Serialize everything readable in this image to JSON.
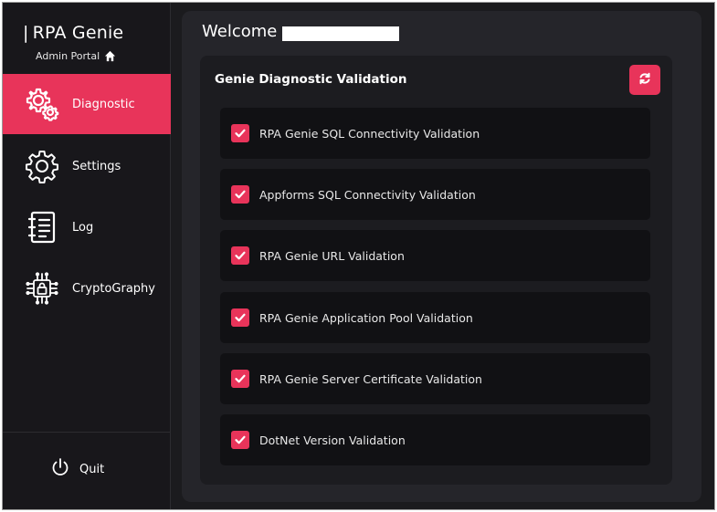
{
  "sidebar": {
    "brand": {
      "bar": "|",
      "title": "RPA Genie",
      "subtitle": "Admin Portal",
      "home_icon": "home-icon"
    },
    "items": [
      {
        "label": "Diagnostic",
        "icon": "diagnostic-gears-icon",
        "active": true
      },
      {
        "label": "Settings",
        "icon": "gear-icon",
        "active": false
      },
      {
        "label": "Log",
        "icon": "notebook-icon",
        "active": false
      },
      {
        "label": "CryptoGraphy",
        "icon": "lock-circuit-icon",
        "active": false
      }
    ],
    "quit": {
      "label": "Quit",
      "icon": "power-icon"
    }
  },
  "main": {
    "welcome": "Welcome",
    "panel": {
      "title": "Genie Diagnostic Validation",
      "refresh_icon": "refresh-icon",
      "checks": [
        {
          "label": "RPA Genie SQL Connectivity Validation",
          "checked": true
        },
        {
          "label": "Appforms SQL Connectivity Validation",
          "checked": true
        },
        {
          "label": "RPA Genie URL Validation",
          "checked": true
        },
        {
          "label": "RPA Genie Application Pool Validation",
          "checked": true
        },
        {
          "label": "RPA Genie Server Certificate Validation",
          "checked": true
        },
        {
          "label": "DotNet Version Validation",
          "checked": true
        }
      ]
    }
  },
  "colors": {
    "accent": "#e8345a",
    "background": "#1b1b1e",
    "sidebar": "#18171b",
    "main": "#25252a",
    "panel": "#1c1c20",
    "row": "#111114"
  }
}
